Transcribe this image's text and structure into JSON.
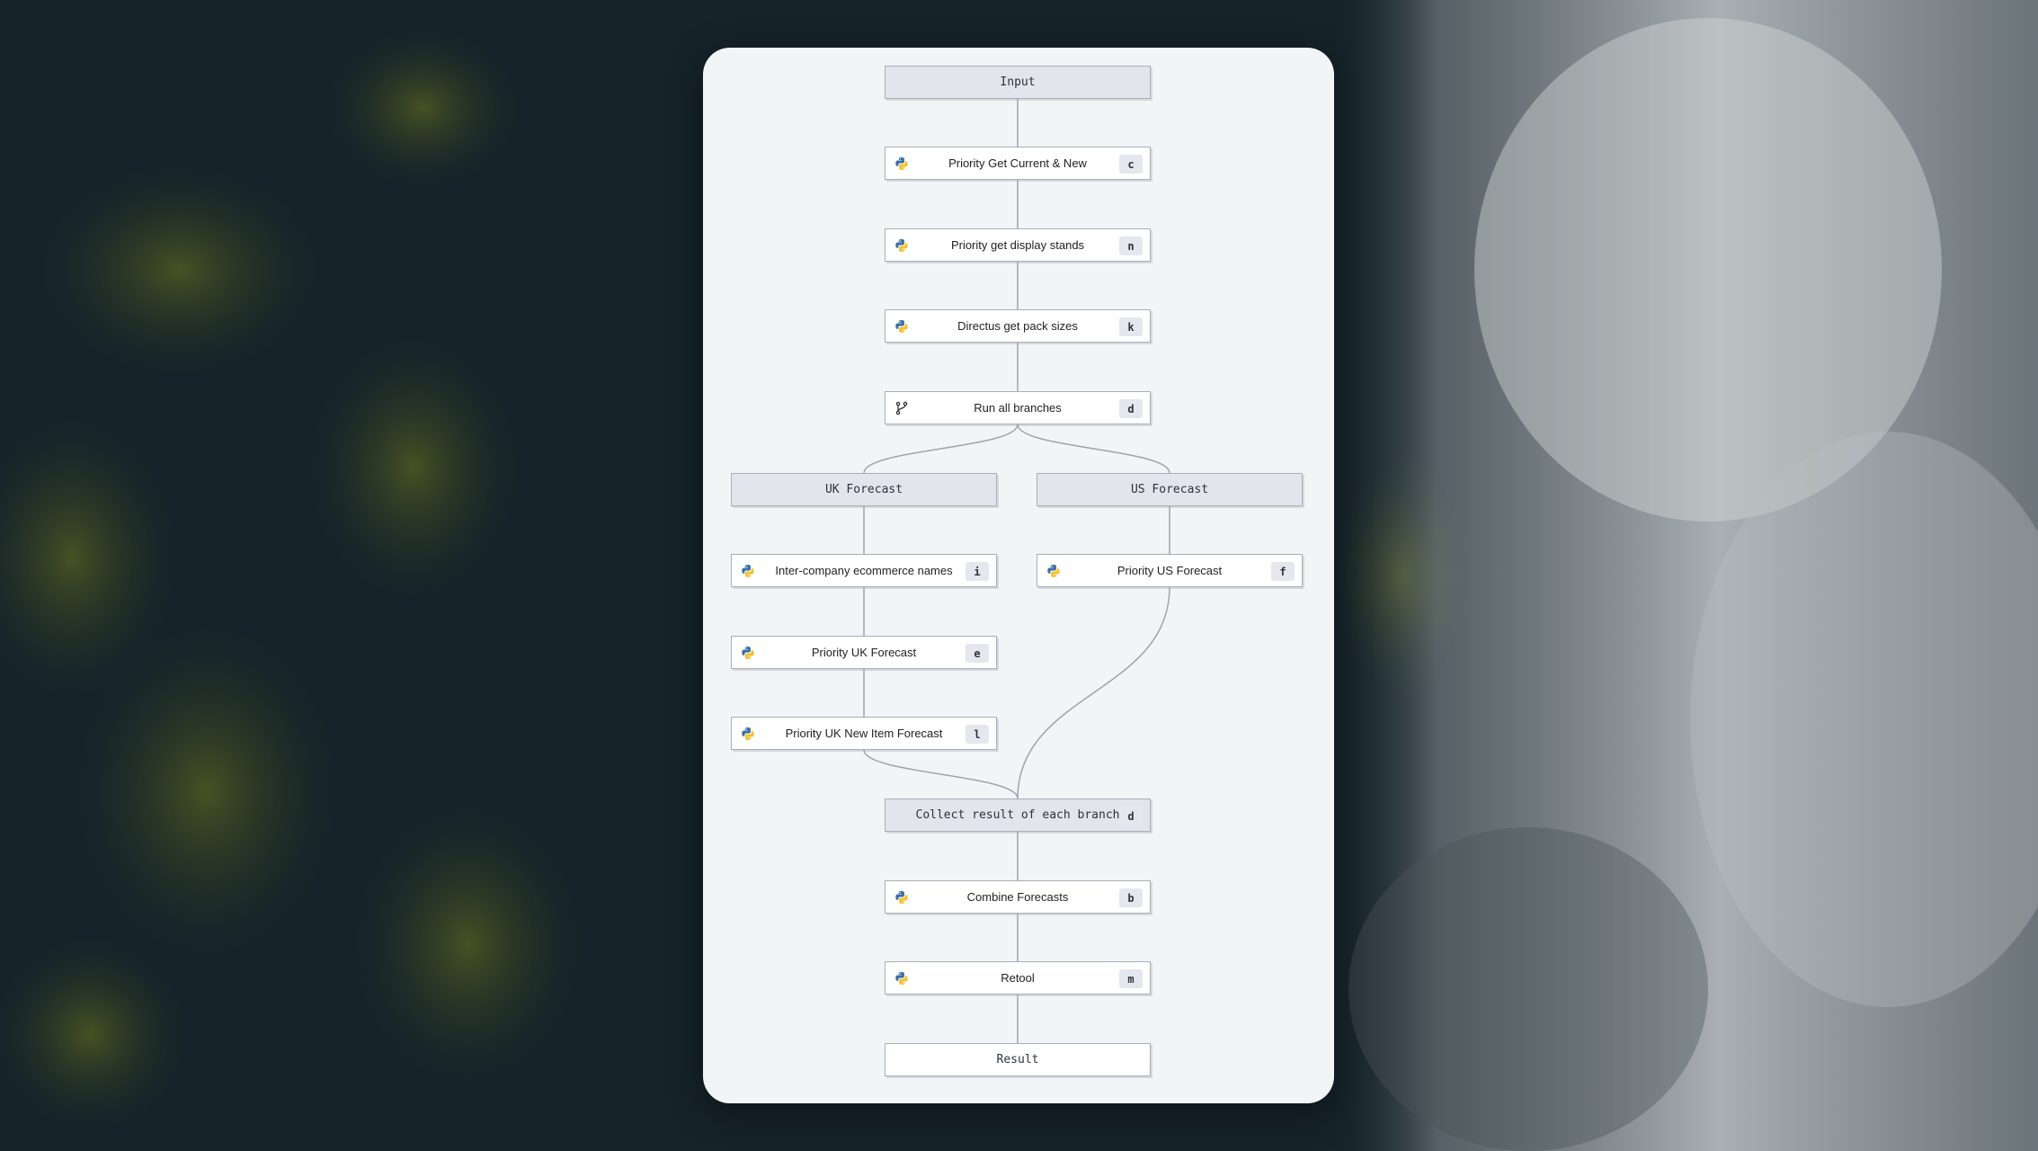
{
  "colors": {
    "card_bg": "#f3f4f6",
    "edge": "#9ea4ad",
    "group_bg": "#e2e5ec",
    "node_border": "#a9afb8"
  },
  "nodes": [
    {
      "id": "input",
      "label": "Input",
      "kind": "group"
    },
    {
      "id": "get_current_new",
      "label": "Priority Get Current & New",
      "kind": "script",
      "icon": "python-icon",
      "key": "c"
    },
    {
      "id": "display_stands",
      "label": "Priority get display stands",
      "kind": "script",
      "icon": "python-icon",
      "key": "n"
    },
    {
      "id": "pack_sizes",
      "label": "Directus get pack sizes",
      "kind": "script",
      "icon": "python-icon",
      "key": "k"
    },
    {
      "id": "run_branches",
      "label": "Run all branches",
      "kind": "branch",
      "icon": "branch-icon",
      "key": "d"
    },
    {
      "id": "uk_forecast",
      "label": "UK Forecast",
      "kind": "group"
    },
    {
      "id": "us_forecast",
      "label": "US Forecast",
      "kind": "group"
    },
    {
      "id": "ecommerce_names",
      "label": "Inter-company ecommerce names",
      "kind": "script",
      "icon": "python-icon",
      "key": "i"
    },
    {
      "id": "us_priority",
      "label": "Priority US Forecast",
      "kind": "script",
      "icon": "python-icon",
      "key": "f"
    },
    {
      "id": "uk_priority",
      "label": "Priority UK Forecast",
      "kind": "script",
      "icon": "python-icon",
      "key": "e"
    },
    {
      "id": "uk_new_item",
      "label": "Priority UK New Item Forecast",
      "kind": "script",
      "icon": "python-icon",
      "key": "l"
    },
    {
      "id": "collect",
      "label": "Collect result of each branch",
      "kind": "group",
      "key": "d"
    },
    {
      "id": "combine",
      "label": "Combine Forecasts",
      "kind": "script",
      "icon": "python-icon",
      "key": "b"
    },
    {
      "id": "retool",
      "label": "Retool",
      "kind": "script",
      "icon": "python-icon",
      "key": "m"
    },
    {
      "id": "result",
      "label": "Result",
      "kind": "terminal"
    }
  ],
  "edges": [
    [
      "input",
      "get_current_new"
    ],
    [
      "get_current_new",
      "display_stands"
    ],
    [
      "display_stands",
      "pack_sizes"
    ],
    [
      "pack_sizes",
      "run_branches"
    ],
    [
      "run_branches",
      "uk_forecast"
    ],
    [
      "run_branches",
      "us_forecast"
    ],
    [
      "uk_forecast",
      "ecommerce_names"
    ],
    [
      "ecommerce_names",
      "uk_priority"
    ],
    [
      "uk_priority",
      "uk_new_item"
    ],
    [
      "uk_new_item",
      "collect"
    ],
    [
      "us_forecast",
      "us_priority"
    ],
    [
      "us_priority",
      "collect"
    ],
    [
      "collect",
      "combine"
    ],
    [
      "combine",
      "retool"
    ],
    [
      "retool",
      "result"
    ]
  ]
}
